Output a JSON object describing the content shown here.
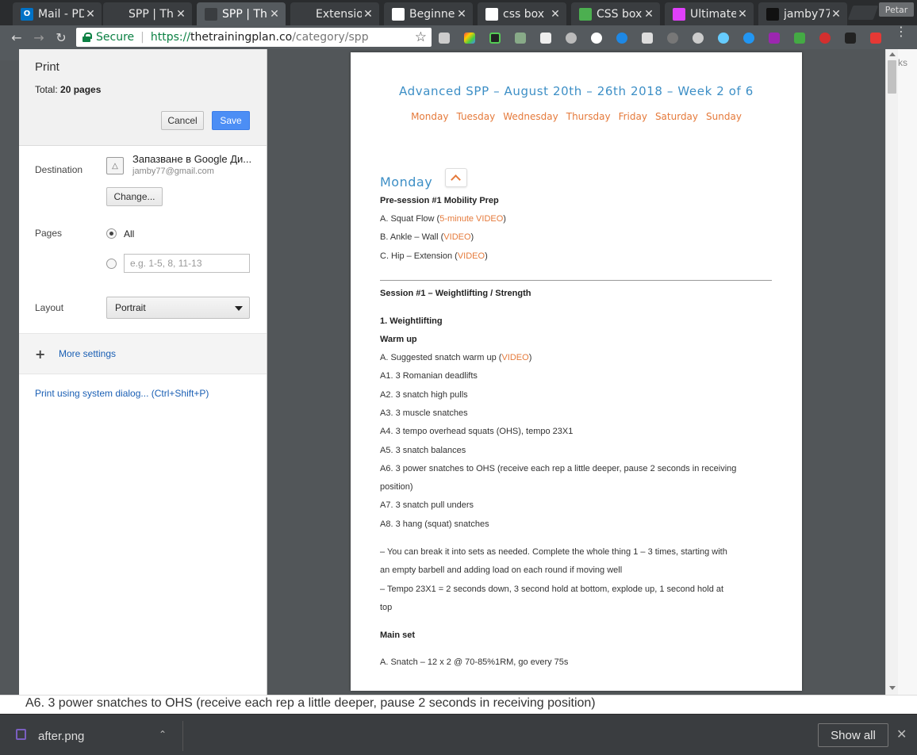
{
  "tabs": [
    {
      "title": "Mail - PD",
      "favicon": "outlook-icon",
      "color": "#0072c6",
      "glyph": "O"
    },
    {
      "title": "SPP | Th",
      "favicon": "page-icon",
      "color": "#3a3d40",
      "glyph": ""
    },
    {
      "title": "SPP | Th",
      "favicon": "page-icon",
      "color": "#3a3d40",
      "glyph": ""
    },
    {
      "title": "Extensio",
      "favicon": "puzzle-icon",
      "color": "#3a3d40",
      "glyph": ""
    },
    {
      "title": "Beginner",
      "favicon": "timer-icon",
      "color": "#fff",
      "glyph": ""
    },
    {
      "title": "css box",
      "favicon": "google-icon",
      "color": "#fff",
      "glyph": ""
    },
    {
      "title": "CSS box",
      "favicon": "chart-icon",
      "color": "#4caf50",
      "glyph": ""
    },
    {
      "title": "Ultimate",
      "favicon": "colorwheel-icon",
      "color": "#e040fb",
      "glyph": ""
    },
    {
      "title": "jamby77",
      "favicon": "github-icon",
      "color": "#111",
      "glyph": ""
    }
  ],
  "profile_name": "Petar",
  "address": {
    "secure_label": "Secure",
    "scheme": "https://",
    "host": "thetrainingplan.co",
    "path": "/category/spp"
  },
  "print": {
    "title": "Print",
    "total_label": "Total:",
    "total_value": "20 pages",
    "cancel": "Cancel",
    "save": "Save",
    "destination_label": "Destination",
    "destination_name": "Запазване в Google Ди...",
    "destination_email": "jamby77@gmail.com",
    "change": "Change...",
    "pages_label": "Pages",
    "pages_all": "All",
    "pages_placeholder": "e.g. 1-5, 8, 11-13",
    "layout_label": "Layout",
    "layout_value": "Portrait",
    "more_settings": "More settings",
    "system_dialog": "Print using system dialog... (Ctrl+Shift+P)"
  },
  "preview": {
    "title": "Advanced SPP – August 20th – 26th 2018 – Week 2 of 6",
    "days": [
      "Monday",
      "Tuesday",
      "Wednesday",
      "Thursday",
      "Friday",
      "Saturday",
      "Sunday"
    ],
    "section": "Monday",
    "pre_session_title": "Pre-session #1 Mobility Prep",
    "pre_items": [
      {
        "text": "A. Squat Flow (",
        "link": "5-minute VIDEO",
        "tail": ")"
      },
      {
        "text": "B. Ankle – Wall (",
        "link": "VIDEO",
        "tail": ")"
      },
      {
        "text": "C. Hip – Extension (",
        "link": "VIDEO",
        "tail": ")"
      }
    ],
    "session_title": "Session #1 – Weightlifting / Strength",
    "weightlifting": "1. Weightlifting",
    "warmup": "Warm up",
    "warmup_first": {
      "text": "A. Suggested snatch warm up (",
      "link": "VIDEO",
      "tail": ")"
    },
    "warmup_items": [
      "A1. 3 Romanian deadlifts",
      "A2. 3 snatch high pulls",
      "A3. 3 muscle snatches",
      "A4. 3 tempo overhead squats (OHS), tempo 23X1",
      "A5. 3 snatch balances",
      "A6. 3 power snatches to OHS (receive each rep a little deeper, pause 2 seconds in receiving",
      "position)",
      "A7. 3 snatch pull unders",
      "A8. 3 hang (squat) snatches"
    ],
    "notes": [
      "– You can break it into sets as needed. Complete the whole thing 1 – 3 times, starting with",
      "an empty barbell and adding load on each round if moving well",
      "– Tempo 23X1 = 2 seconds down, 3 second hold at bottom, explode up, 1 second hold at",
      "top"
    ],
    "main_set": "Main set",
    "main_item": "A. Snatch – 12 x 2 @ 70-85%1RM, go every 75s"
  },
  "right_edge_text": "ks",
  "background_text": "A6. 3 power snatches to OHS (receive each rep a little deeper, pause 2 seconds in receiving position)",
  "downloads": {
    "file": "after.png",
    "show_all": "Show all"
  },
  "colors": {
    "accent_blue": "#3d8fc6",
    "accent_orange": "#e57a3b",
    "save_button": "#4c8ef5"
  }
}
